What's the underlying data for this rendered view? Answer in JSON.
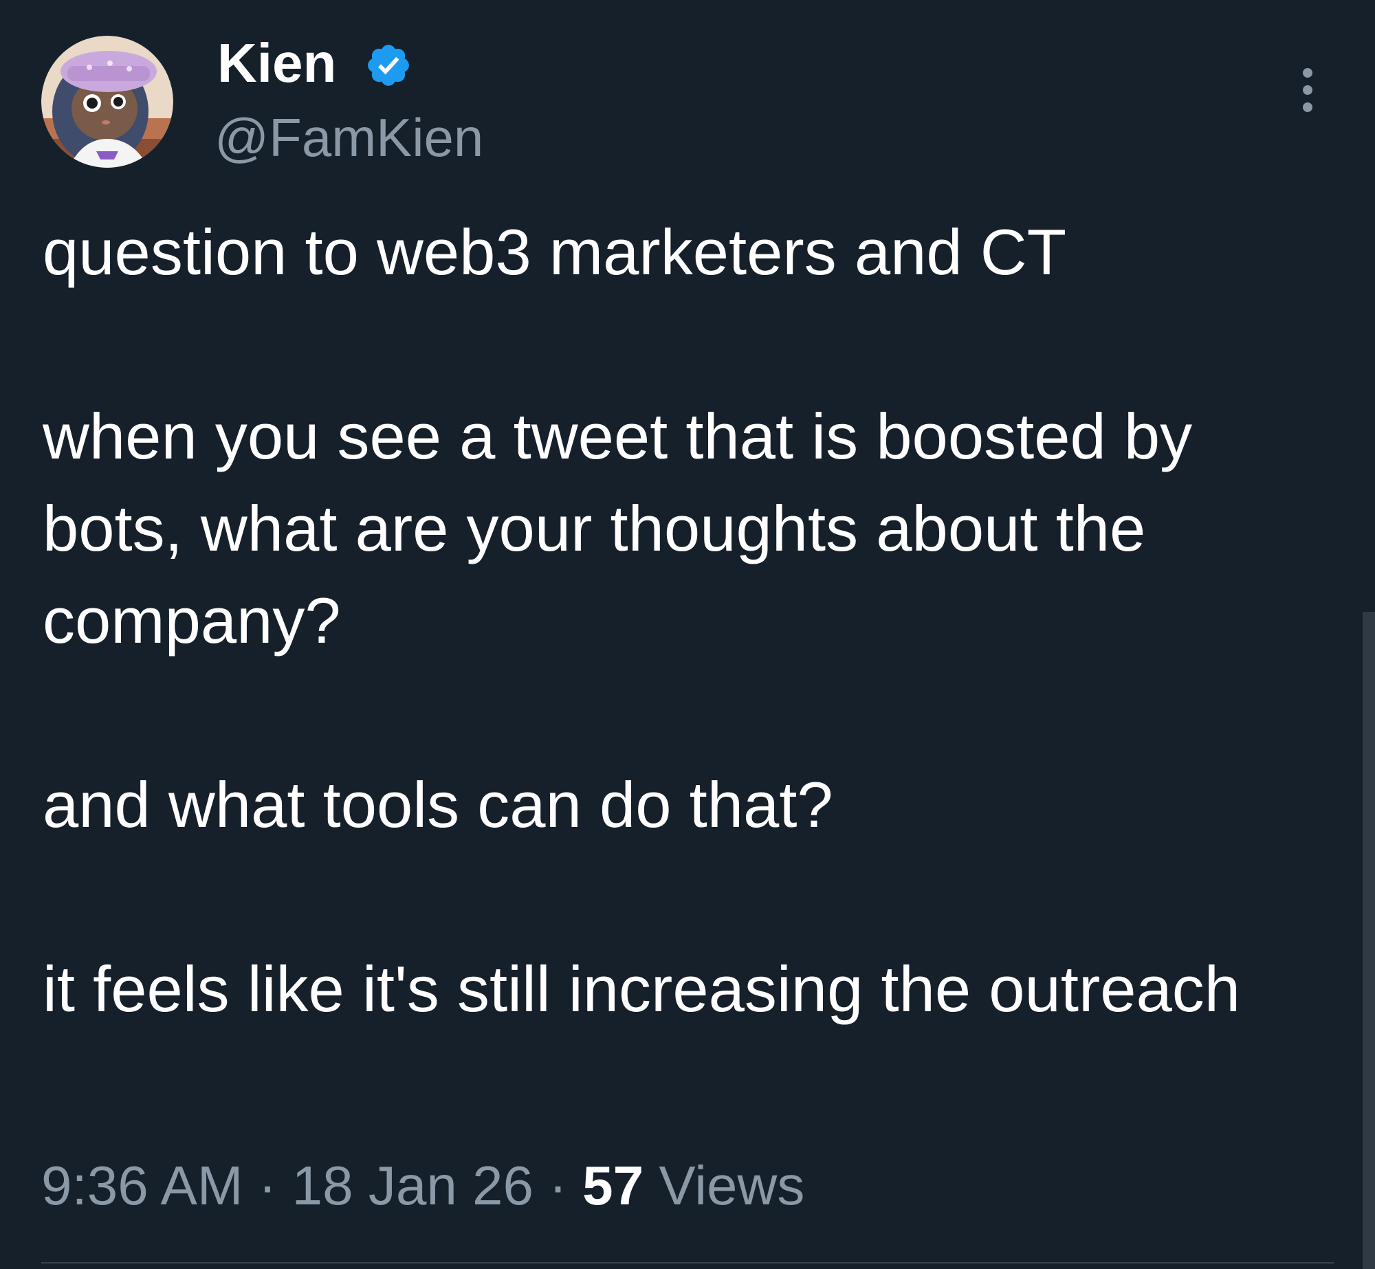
{
  "author": {
    "display_name": "Kien",
    "handle": "@FamKien",
    "verified_icon": "verified-badge-icon",
    "avatar": "avatar-image"
  },
  "menu": {
    "icon": "more-vertical-icon"
  },
  "tweet": {
    "paragraphs": [
      "question to web3 marketers and CT",
      "when you see a tweet that is boosted by bots, what are your thoughts about the company?",
      "and what tools can do that?",
      "it feels like it's still increasing the outreach"
    ]
  },
  "meta": {
    "time": "9:36 AM",
    "separator": "·",
    "date": "18 Jan 26",
    "views_count": "57",
    "views_label": "Views"
  },
  "colors": {
    "background": "#15202b",
    "text_primary": "#ffffff",
    "text_secondary": "#8b98a5",
    "verified_blue": "#1d9bf0",
    "divider": "#38444d"
  }
}
